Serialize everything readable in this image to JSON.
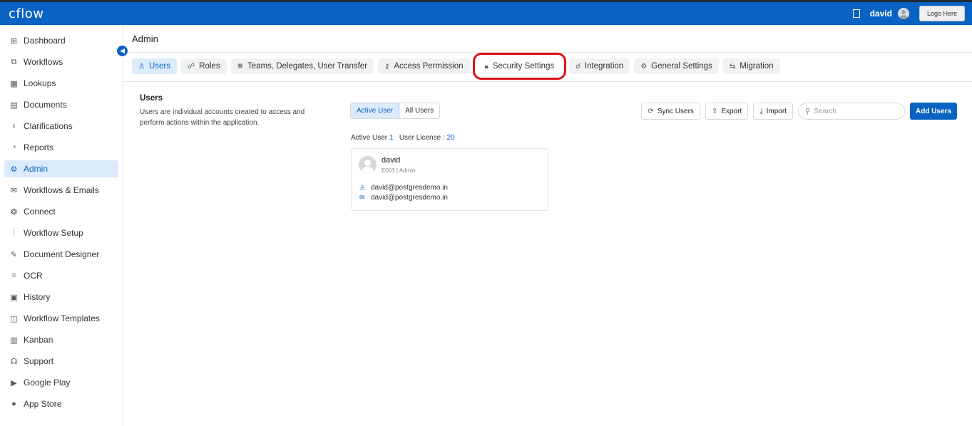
{
  "header": {
    "logo": "cflow",
    "user_name": "david",
    "logo_button": "Logo Here"
  },
  "sidebar": {
    "items": [
      {
        "label": "Dashboard",
        "icon": "dashboard-icon",
        "glyph": "⊞"
      },
      {
        "label": "Workflows",
        "icon": "workflows-icon",
        "glyph": "⧉"
      },
      {
        "label": "Lookups",
        "icon": "lookups-icon",
        "glyph": "▦"
      },
      {
        "label": "Documents",
        "icon": "documents-icon",
        "glyph": "▤"
      },
      {
        "label": "Clarifications",
        "icon": "clarifications-icon",
        "glyph": "♁"
      },
      {
        "label": "Reports",
        "icon": "reports-icon",
        "glyph": "◔"
      },
      {
        "label": "Admin",
        "icon": "admin-icon",
        "glyph": "⚙"
      },
      {
        "label": "Workflows & Emails",
        "icon": "mail-icon",
        "glyph": "✉"
      },
      {
        "label": "Connect",
        "icon": "connect-icon",
        "glyph": "❂"
      },
      {
        "label": "Workflow Setup",
        "icon": "workflow-setup-icon",
        "glyph": "⫶"
      },
      {
        "label": "Document Designer",
        "icon": "document-designer-icon",
        "glyph": "✎"
      },
      {
        "label": "OCR",
        "icon": "ocr-icon",
        "glyph": "⌗"
      },
      {
        "label": "History",
        "icon": "history-icon",
        "glyph": "▣"
      },
      {
        "label": "Workflow Templates",
        "icon": "templates-icon",
        "glyph": "◫"
      },
      {
        "label": "Kanban",
        "icon": "kanban-icon",
        "glyph": "▥"
      },
      {
        "label": "Support",
        "icon": "support-icon",
        "glyph": "☊"
      },
      {
        "label": "Google Play",
        "icon": "google-play-icon",
        "glyph": "▶"
      },
      {
        "label": "App Store",
        "icon": "apple-icon",
        "glyph": "●"
      }
    ],
    "active_index": 6
  },
  "main": {
    "title": "Admin",
    "tabs": [
      {
        "label": "Users",
        "icon": "user-icon",
        "glyph": "♙"
      },
      {
        "label": "Roles",
        "icon": "roles-icon",
        "glyph": "☍"
      },
      {
        "label": "Teams, Delegates, User Transfer",
        "icon": "teams-icon",
        "glyph": "❋"
      },
      {
        "label": "Access Permission",
        "icon": "key-icon",
        "glyph": "⚷"
      },
      {
        "label": "Security Settings",
        "icon": "lock-icon",
        "glyph": "🔒︎"
      },
      {
        "label": "Integration",
        "icon": "integration-icon",
        "glyph": "☌"
      },
      {
        "label": "General Settings",
        "icon": "gear-icon",
        "glyph": "⚙"
      },
      {
        "label": "Migration",
        "icon": "migration-icon",
        "glyph": "⇆"
      }
    ],
    "active_tab": 0,
    "highlighted_tab": 4,
    "section": {
      "title": "Users",
      "description": "Users are individual accounts created to access and perform actions within the application."
    },
    "toggle": {
      "active": "Active User",
      "all": "All Users"
    },
    "counts": {
      "active_label": "Active User",
      "active_value": "1",
      "license_label": "User License :",
      "license_value": "20"
    },
    "actions": {
      "sync": "Sync Users",
      "export": "Export",
      "import": "Import",
      "search_placeholder": "Search",
      "add": "Add Users"
    },
    "user_card": {
      "name": "david",
      "sub": "E001 | Admin",
      "username": "david@postgresdemo.in",
      "email": "david@postgresdemo.in"
    }
  },
  "colors": {
    "primary": "#0A63C2",
    "highlight": "#E0101C"
  }
}
